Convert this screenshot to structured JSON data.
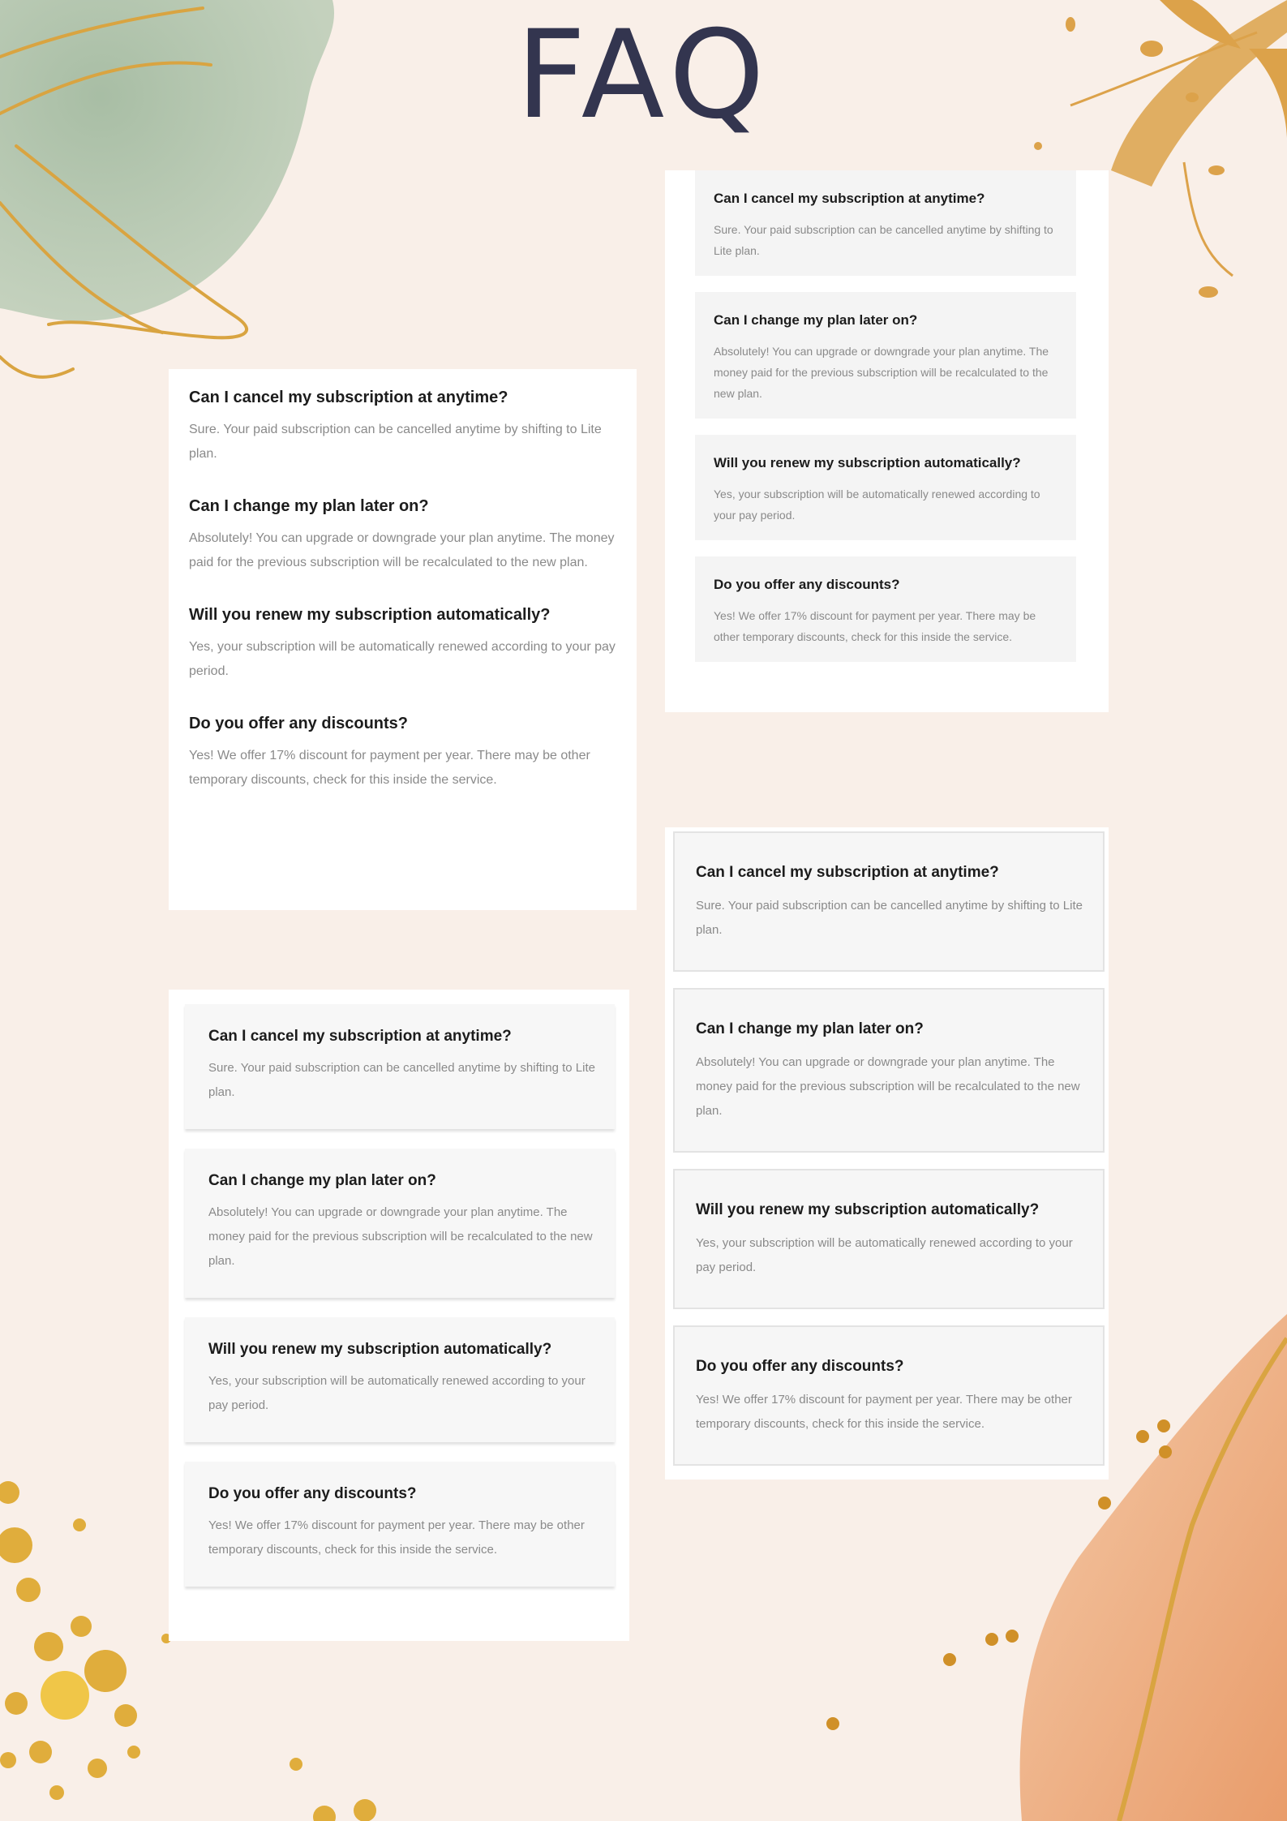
{
  "page": {
    "title": "FAQ"
  },
  "faq": [
    {
      "question": "Can I cancel my subscription at anytime?",
      "answer": "Sure. Your paid subscription can be cancelled anytime by shifting to Lite plan."
    },
    {
      "question": "Can I change my plan later on?",
      "answer": "Absolutely! You can upgrade or downgrade your plan anytime. The money paid for the previous subscription will be recalculated to the new plan."
    },
    {
      "question": "Will you renew my subscription automatically?",
      "answer": "Yes, your subscription will be automatically renewed according to your pay period."
    },
    {
      "question": "Do you offer any discounts?",
      "answer": "Yes! We offer 17% discount for payment per year. There may be other temporary discounts, check for this inside the service."
    }
  ],
  "colors": {
    "background": "#f9efe8",
    "title": "#33354f",
    "question": "#1c1c1c",
    "answer": "#8a8a8a",
    "gold": "#d9a441",
    "sage": "#a9c0a8",
    "peach": "#eba06d"
  }
}
